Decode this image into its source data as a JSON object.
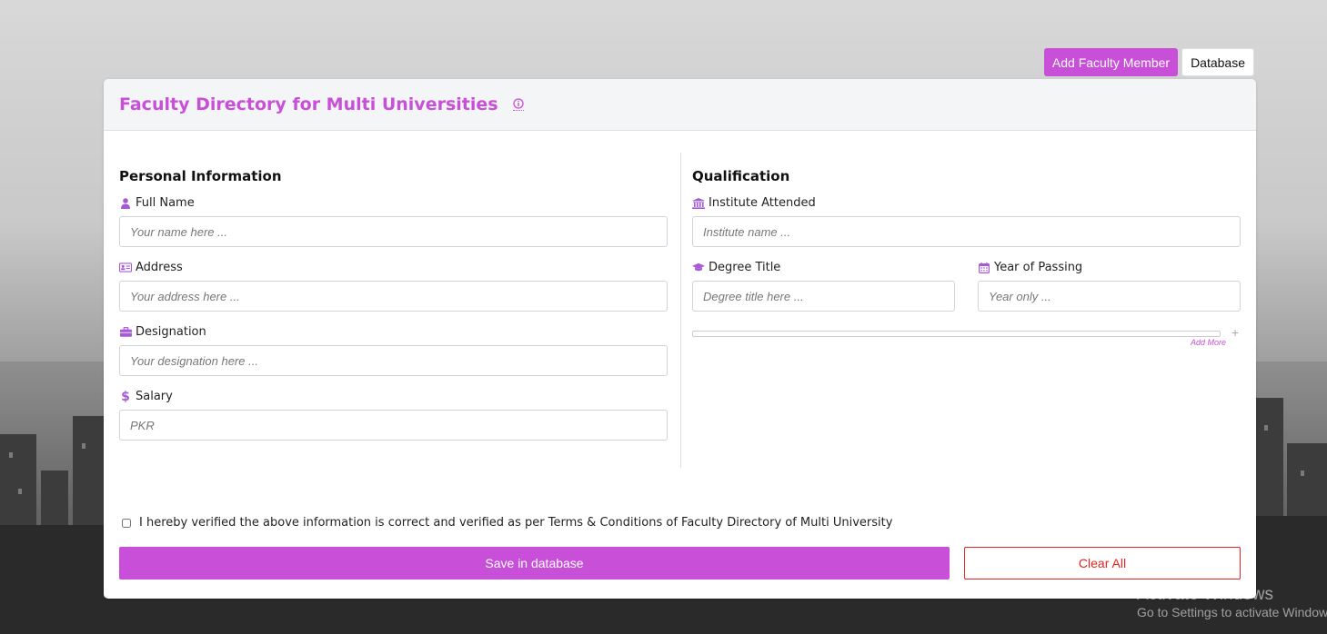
{
  "top_actions": {
    "add_label": "Add Faculty Member",
    "database_label": "Database"
  },
  "header": {
    "title": "Faculty Directory for Multi Universities"
  },
  "personal": {
    "title": "Personal Information",
    "full_name": {
      "label": "Full Name",
      "placeholder": "Your name here ..."
    },
    "address": {
      "label": "Address",
      "placeholder": "Your address here ..."
    },
    "designation": {
      "label": "Designation",
      "placeholder": "Your designation here ..."
    },
    "salary": {
      "label": "Salary",
      "placeholder": "PKR"
    }
  },
  "qualification": {
    "title": "Qualification",
    "institute": {
      "label": "Institute Attended",
      "placeholder": "Institute name ..."
    },
    "degree": {
      "label": "Degree Title",
      "placeholder": "Degree title here ..."
    },
    "year": {
      "label": "Year of Passing",
      "placeholder": "Year only ..."
    },
    "add_more": "Add More",
    "plus": "+"
  },
  "verify_text": "I hereby verified the above information is correct and verified as per Terms & Conditions of Faculty Directory of Multi University",
  "actions": {
    "save_label": "Save in database",
    "clear_label": "Clear All"
  },
  "watermark": {
    "line1": "Activate Windows",
    "line2": "Go to Settings to activate Windows."
  },
  "colors": {
    "accent": "#c84fd8",
    "danger": "#e02424"
  },
  "icons": [
    "user-icon",
    "id-card-icon",
    "briefcase-icon",
    "dollar-icon",
    "institution-icon",
    "graduation-cap-icon",
    "calendar-icon",
    "info-icon"
  ]
}
